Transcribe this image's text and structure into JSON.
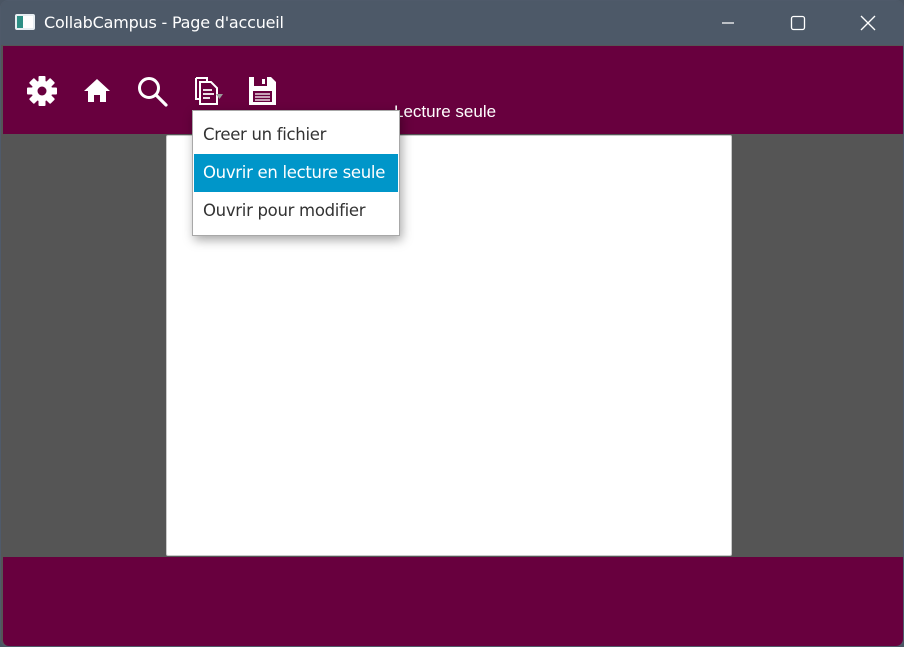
{
  "window": {
    "title": "CollabCampus - Page d'accueil",
    "controls": [
      "minimize-icon",
      "maximize-icon",
      "close-icon"
    ]
  },
  "toolbar": {
    "background": "#68003e",
    "icons": [
      "gear-icon",
      "home-icon",
      "search-icon",
      "file-menu-icon",
      "save-icon"
    ],
    "mode_label": "Lecture seule"
  },
  "file_menu": {
    "items": [
      {
        "label": "Creer un fichier",
        "selected": false
      },
      {
        "label": "Ouvrir en lecture seule",
        "selected": true
      },
      {
        "label": "Ouvrir pour modifier",
        "selected": false
      }
    ],
    "highlight_color": "#0096c9"
  },
  "editor": {
    "content": ""
  },
  "colors": {
    "titlebar": "#4d5968",
    "workspace": "#555555",
    "accent": "#68003e"
  }
}
